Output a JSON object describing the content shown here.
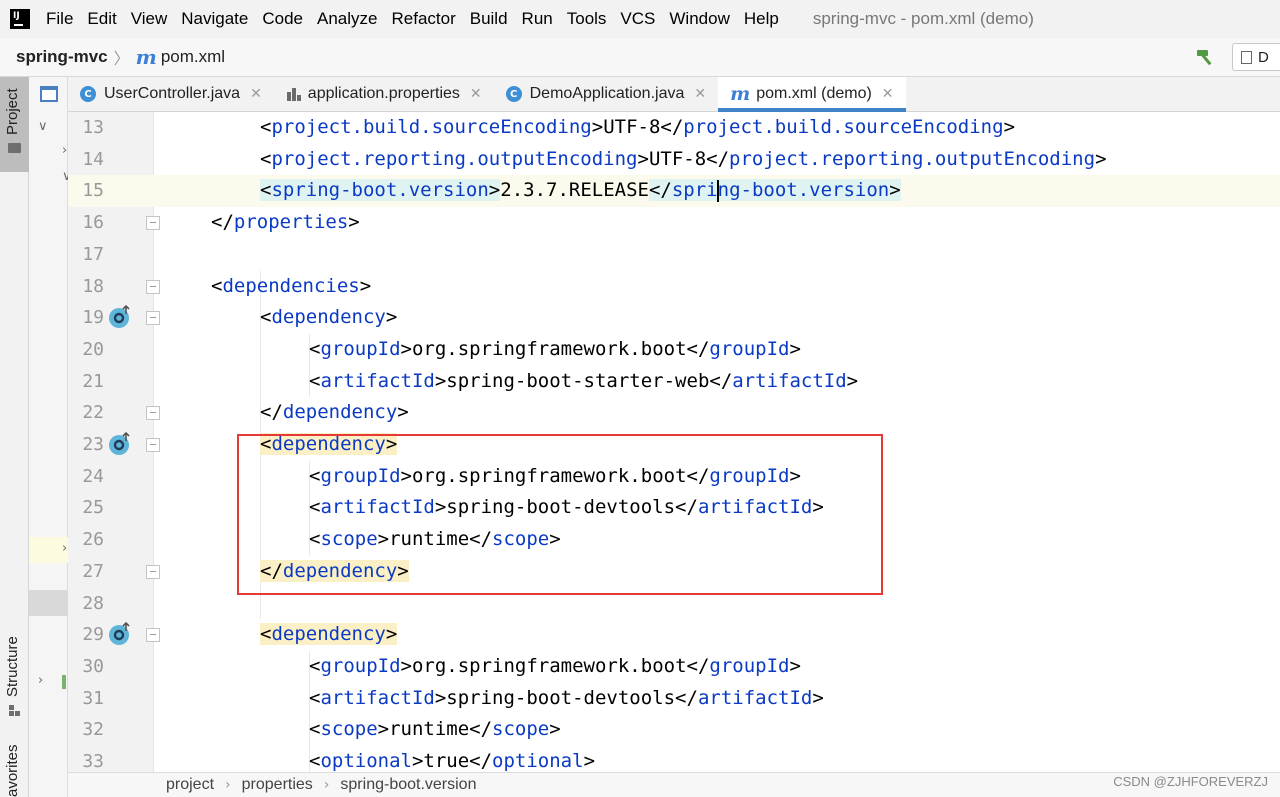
{
  "menubar": {
    "items": [
      "File",
      "Edit",
      "View",
      "Navigate",
      "Code",
      "Analyze",
      "Refactor",
      "Build",
      "Run",
      "Tools",
      "VCS",
      "Window",
      "Help"
    ],
    "window_title": "spring-mvc - pom.xml (demo)"
  },
  "navbar": {
    "project": "spring-mvc",
    "file": "pom.xml",
    "run_config_label": "D"
  },
  "toolwindows": {
    "project": "Project",
    "structure": "Structure",
    "favorites": "avorites"
  },
  "tabs": [
    {
      "label": "UserController.java",
      "icon": "java-class-icon",
      "active": false
    },
    {
      "label": "application.properties",
      "icon": "properties-file-icon",
      "active": false
    },
    {
      "label": "DemoApplication.java",
      "icon": "spring-boot-class-icon",
      "active": false
    },
    {
      "label": "pom.xml (demo)",
      "icon": "maven-icon",
      "active": true
    }
  ],
  "editor": {
    "lines": [
      {
        "n": "13",
        "indent": 2,
        "text": "<project.build.sourceEncoding>UTF-8</project.build.sourceEncoding>"
      },
      {
        "n": "14",
        "indent": 2,
        "text": "<project.reporting.outputEncoding>UTF-8</project.reporting.outputEncoding>"
      },
      {
        "n": "15",
        "indent": 2,
        "text": "<spring-boot.version>2.3.7.RELEASE</spring-boot.version>",
        "current": true
      },
      {
        "n": "16",
        "indent": 1,
        "text": "</properties>",
        "fold": "close"
      },
      {
        "n": "17",
        "indent": 0,
        "text": ""
      },
      {
        "n": "18",
        "indent": 1,
        "text": "<dependencies>",
        "fold": "open"
      },
      {
        "n": "19",
        "indent": 2,
        "text": "<dependency>",
        "fold": "open",
        "dep_icon": true
      },
      {
        "n": "20",
        "indent": 3,
        "text": "<groupId>org.springframework.boot</groupId>"
      },
      {
        "n": "21",
        "indent": 3,
        "text": "<artifactId>spring-boot-starter-web</artifactId>"
      },
      {
        "n": "22",
        "indent": 2,
        "text": "</dependency>",
        "fold": "close"
      },
      {
        "n": "23",
        "indent": 2,
        "text": "<dependency>",
        "fold": "open",
        "dep_icon": true,
        "tag_hl": true
      },
      {
        "n": "24",
        "indent": 3,
        "text": "<groupId>org.springframework.boot</groupId>"
      },
      {
        "n": "25",
        "indent": 3,
        "text": "<artifactId>spring-boot-devtools</artifactId>"
      },
      {
        "n": "26",
        "indent": 3,
        "text": "<scope>runtime</scope>"
      },
      {
        "n": "27",
        "indent": 2,
        "text": "</dependency>",
        "fold": "close",
        "tag_hl": true
      },
      {
        "n": "28",
        "indent": 0,
        "text": ""
      },
      {
        "n": "29",
        "indent": 2,
        "text": "<dependency>",
        "fold": "open",
        "dep_icon": true,
        "tag_hl": true
      },
      {
        "n": "30",
        "indent": 3,
        "text": "<groupId>org.springframework.boot</groupId>"
      },
      {
        "n": "31",
        "indent": 3,
        "text": "<artifactId>spring-boot-devtools</artifactId>"
      },
      {
        "n": "32",
        "indent": 3,
        "text": "<scope>runtime</scope>"
      },
      {
        "n": "33",
        "indent": 3,
        "text": "<optional>true</optional>"
      }
    ]
  },
  "statusbar": {
    "crumbs": [
      "project",
      "properties",
      "spring-boot.version"
    ]
  },
  "watermark": "CSDN @ZJHFOREVERZJ",
  "colors": {
    "tag": "#0a3ac4",
    "annotation_box": "#e53935",
    "active_tab_underline": "#4083c9",
    "current_line": "#fcfaed"
  }
}
